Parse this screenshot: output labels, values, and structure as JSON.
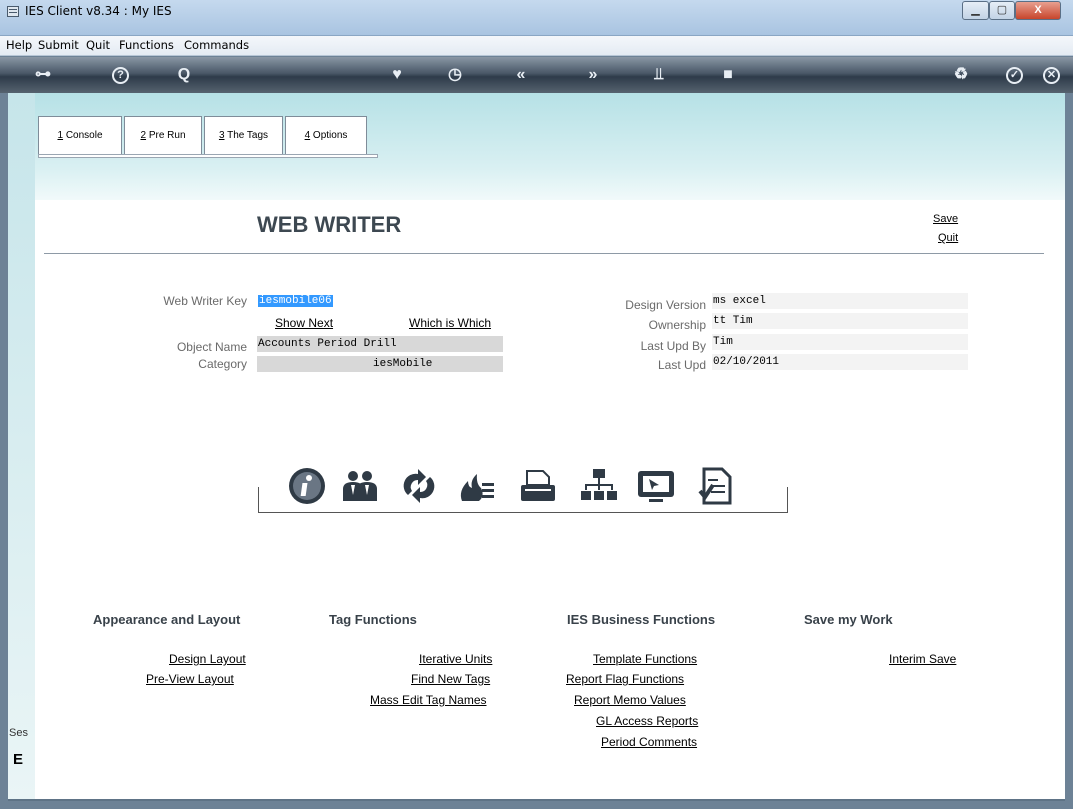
{
  "window": {
    "title": "IES Client v8.34 : My IES",
    "min": "▁",
    "max": "▢",
    "close": "X"
  },
  "menu": [
    "Help",
    "Submit",
    "Quit",
    "Functions",
    "Commands"
  ],
  "toolbar": [
    {
      "name": "key-icon",
      "glyph": "⊶"
    },
    {
      "name": "help-icon",
      "glyph": "?"
    },
    {
      "name": "search-icon",
      "glyph": "Q"
    },
    {
      "name": "heart-icon",
      "glyph": "♥"
    },
    {
      "name": "clock-icon",
      "glyph": "◷"
    },
    {
      "name": "rewind-icon",
      "glyph": "«"
    },
    {
      "name": "forward-icon",
      "glyph": "»"
    },
    {
      "name": "tools-icon",
      "glyph": "⫫"
    },
    {
      "name": "stop-icon",
      "glyph": "■"
    },
    {
      "name": "recycle-icon",
      "glyph": "♻"
    },
    {
      "name": "check-icon",
      "glyph": "✓"
    },
    {
      "name": "close-icon",
      "glyph": "✕"
    }
  ],
  "tabs": [
    {
      "num": "1",
      "label": " Console"
    },
    {
      "num": "2",
      "label": " Pre Run"
    },
    {
      "num": "3",
      "label": " The Tags"
    },
    {
      "num": "4",
      "label": " Options"
    }
  ],
  "page": {
    "title": "WEB WRITER",
    "save": "Save",
    "quit": "Quit"
  },
  "form": {
    "key_label": "Web Writer Key",
    "key_value": "iesmobile06",
    "show_next": "Show Next",
    "which_is_which": "Which is Which",
    "object_name_label": "Object Name",
    "object_name_value": "Accounts Period Drill",
    "category_label": "Category",
    "category_value": "iesMobile",
    "design_version_label": "Design Version",
    "design_version_value": "ms excel",
    "ownership_label": "Ownership",
    "ownership_value": "tt Tim",
    "last_upd_by_label": "Last Upd By",
    "last_upd_by_value": "Tim",
    "last_upd_label": "Last Upd",
    "last_upd_value": "02/10/2011"
  },
  "sections": {
    "appearance": {
      "title": "Appearance and Layout",
      "links": [
        "Design Layout",
        "Pre-View Layout"
      ]
    },
    "tags": {
      "title": "Tag Functions",
      "links": [
        "Iterative Units",
        "Find New Tags",
        "Mass Edit Tag Names"
      ]
    },
    "business": {
      "title": "IES Business Functions",
      "links": [
        "Template Functions",
        "Report Flag Functions",
        "Report Memo Values",
        "GL Access Reports",
        "Period Comments"
      ]
    },
    "save": {
      "title": "Save my Work",
      "links": [
        "Interim Save"
      ]
    }
  },
  "status": {
    "ses": "Ses",
    "glyph": "E"
  },
  "colors": {
    "accent": "#3399ff",
    "banner": "#b6e1e6",
    "toolbar": "#3a4858"
  }
}
